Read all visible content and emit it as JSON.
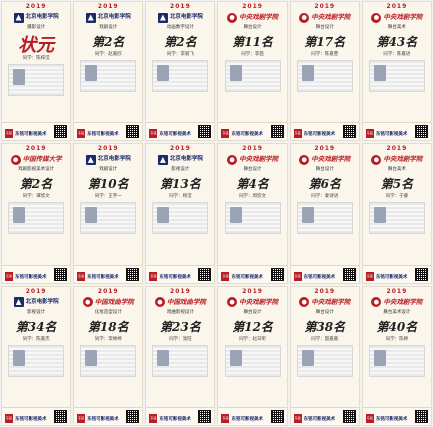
{
  "cards": [
    {
      "year": "2019",
      "school": "北京电影学院",
      "major": "摄影设计",
      "rank": "状元",
      "student": "同学：陈梓滢",
      "champion": true,
      "red": false
    },
    {
      "year": "2019",
      "school": "北京电影学院",
      "major": "戏剧设计",
      "rank": "第2名",
      "student": "同学：赵嘉欣",
      "champion": false,
      "red": false
    },
    {
      "year": "2019",
      "school": "北京电影学院",
      "major": "动画数字设计",
      "rank": "第2名",
      "student": "同学：李丽飞",
      "champion": false,
      "red": false
    },
    {
      "year": "2019",
      "school": "中央戏剧学院",
      "major": "舞台设计",
      "rank": "第11名",
      "student": "同学：李茜",
      "champion": false,
      "red": true
    },
    {
      "year": "2019",
      "school": "中央戏剧学院",
      "major": "舞台设计",
      "rank": "第17名",
      "student": "同学：陈嘉雯",
      "champion": false,
      "red": true
    },
    {
      "year": "2019",
      "school": "中央戏剧学院",
      "major": "舞台美术",
      "rank": "第43名",
      "student": "同学：陈嘉语",
      "champion": false,
      "red": true
    },
    {
      "year": "2019",
      "school": "中国传媒大学",
      "major": "戏剧影视美术设计",
      "rank": "第2名",
      "student": "同学：谭欣文",
      "champion": false,
      "red": true
    },
    {
      "year": "2019",
      "school": "北京电影学院",
      "major": "戏剧设计",
      "rank": "第10名",
      "student": "同学：王宇一",
      "champion": false,
      "red": false
    },
    {
      "year": "2019",
      "school": "北京电影学院",
      "major": "影视设计",
      "rank": "第13名",
      "student": "同学：杨滢",
      "champion": false,
      "red": false
    },
    {
      "year": "2019",
      "school": "中央戏剧学院",
      "major": "舞台设计",
      "rank": "第4名",
      "student": "同学：周欣文",
      "champion": false,
      "red": true
    },
    {
      "year": "2019",
      "school": "中央戏剧学院",
      "major": "舞台设计",
      "rank": "第6名",
      "student": "同学：秦诗语",
      "champion": false,
      "red": true
    },
    {
      "year": "2019",
      "school": "中央戏剧学院",
      "major": "舞台美术",
      "rank": "第5名",
      "student": "同学：于睿",
      "champion": false,
      "red": true
    },
    {
      "year": "2019",
      "school": "北京电影学院",
      "major": "影视设计",
      "rank": "第34名",
      "student": "同学：陈嘉杰",
      "champion": false,
      "red": false
    },
    {
      "year": "2019",
      "school": "中国戏曲学院",
      "major": "化妆造型设计",
      "rank": "第18名",
      "student": "同学：李婷婷",
      "champion": false,
      "red": true
    },
    {
      "year": "2019",
      "school": "中国戏曲学院",
      "major": "戏曲影视设计",
      "rank": "第23名",
      "student": "同学：温旺",
      "champion": false,
      "red": true
    },
    {
      "year": "2019",
      "school": "中央戏剧学院",
      "major": "舞台设计",
      "rank": "第12名",
      "student": "同学：赵日昕",
      "champion": false,
      "red": true
    },
    {
      "year": "2019",
      "school": "中央戏剧学院",
      "major": "舞台设计",
      "rank": "第38名",
      "student": "同学：殷嘉嘉",
      "champion": false,
      "red": true
    },
    {
      "year": "2019",
      "school": "中央戏剧学院",
      "major": "舞台美术设计",
      "rank": "第40名",
      "student": "同学：陈婷",
      "champion": false,
      "red": true
    }
  ],
  "footer": {
    "studio": "东铭可影视美术",
    "badge": "东铭"
  }
}
